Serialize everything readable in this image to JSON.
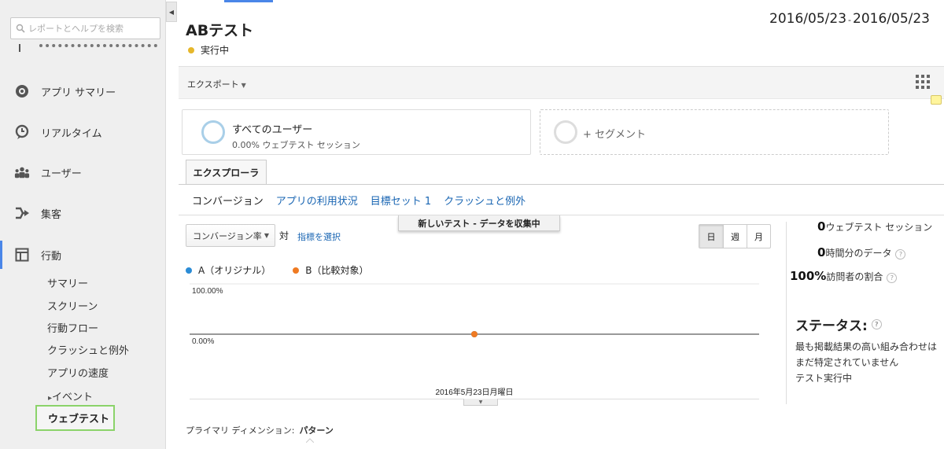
{
  "sidebar": {
    "search_placeholder": "レポートとヘルプを検索",
    "items": [
      {
        "label": "アプリ サマリー",
        "icon": "app-summary-icon"
      },
      {
        "label": "リアルタイム",
        "icon": "clock-icon"
      },
      {
        "label": "ユーザー",
        "icon": "users-icon"
      },
      {
        "label": "集客",
        "icon": "acquisition-arrow-icon"
      },
      {
        "label": "行動",
        "icon": "behavior-icon"
      }
    ],
    "sub_items": [
      "サマリー",
      "スクリーン",
      "行動フロー",
      "クラッシュと例外",
      "アプリの速度"
    ],
    "events_label": "イベント",
    "selected_label": "ウェブテスト"
  },
  "header": {
    "date_start": "2016/05/23",
    "date_sep": "-",
    "date_end": "2016/05/23",
    "title": "ABテスト",
    "status": "実行中",
    "status_color": "#e6b72b"
  },
  "toolbar": {
    "export_label": "エクスポート"
  },
  "segments": {
    "all_users_title": "すべてのユーザー",
    "all_users_sub": "0.00% ウェブテスト セッション",
    "add_segment": "+ セグメント"
  },
  "tabs": {
    "explorer": "エクスプローラ",
    "subtabs": [
      "コンバージョン",
      "アプリの利用状況",
      "目標セット 1",
      "クラッシュと例外"
    ]
  },
  "banner": "新しいテスト - データを収集中",
  "controls": {
    "metric": "コンバージョン率",
    "vs": "対",
    "choose_metric": "指標を選択",
    "periods": [
      "日",
      "週",
      "月"
    ]
  },
  "chart_data": {
    "type": "line",
    "x": [
      "2016年5月23日月曜日"
    ],
    "series": [
      {
        "name": "A（オリジナル）",
        "color": "#2b8cd6",
        "values": [
          0
        ]
      },
      {
        "name": "B（比較対象）",
        "color": "#ef7a22",
        "values": [
          0
        ]
      }
    ],
    "ytick_labels": [
      "100.00%",
      "0.00%"
    ],
    "ylim": [
      0,
      100
    ],
    "xtick_label": "2016年5月23日月曜日"
  },
  "stats": [
    {
      "value": "0",
      "label": "ウェブテスト セッション",
      "help": false
    },
    {
      "value": "0",
      "label": "時間分のデータ",
      "help": true
    },
    {
      "value": "100%",
      "label": "訪問者の割合",
      "help": true
    }
  ],
  "status_panel": {
    "title": "ステータス:",
    "lines": [
      "最も掲載結果の高い組み合わせはまだ特定されていません",
      "テスト実行中"
    ]
  },
  "primary_dimension": {
    "label": "プライマリ ディメンション:",
    "value": "パターン"
  },
  "help_glyph": "?",
  "collapse_glyph": "◀",
  "tri_glyph": "▸",
  "caret_glyph": "▼"
}
